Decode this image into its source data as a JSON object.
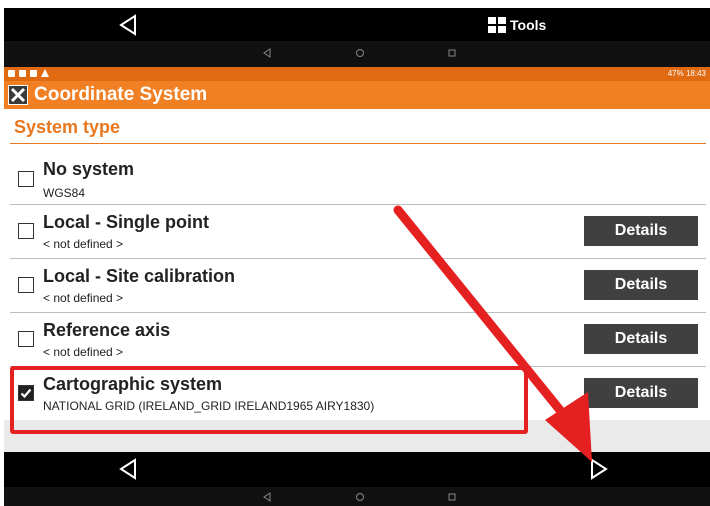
{
  "toolbar": {
    "tools_label": "Tools"
  },
  "status": {
    "right_text": "47% 18:43"
  },
  "app": {
    "title": "Coordinate System"
  },
  "section": {
    "title": "System type"
  },
  "systems": [
    {
      "title": "No system",
      "subtitle": "WGS84",
      "checked": false,
      "has_details": false
    },
    {
      "title": "Local - Single point",
      "subtitle": "< not defined >",
      "checked": false,
      "has_details": true,
      "details_label": "Details"
    },
    {
      "title": "Local - Site calibration",
      "subtitle": "< not defined >",
      "checked": false,
      "has_details": true,
      "details_label": "Details"
    },
    {
      "title": "Reference axis",
      "subtitle": "< not defined >",
      "checked": false,
      "has_details": true,
      "details_label": "Details"
    },
    {
      "title": "Cartographic system",
      "subtitle": "NATIONAL GRID (IRELAND_GRID IRELAND1965 AIRY1830)",
      "checked": true,
      "has_details": true,
      "details_label": "Details"
    }
  ],
  "colors": {
    "accent": "#f08023",
    "highlight": "#e52020",
    "button": "#404040"
  }
}
